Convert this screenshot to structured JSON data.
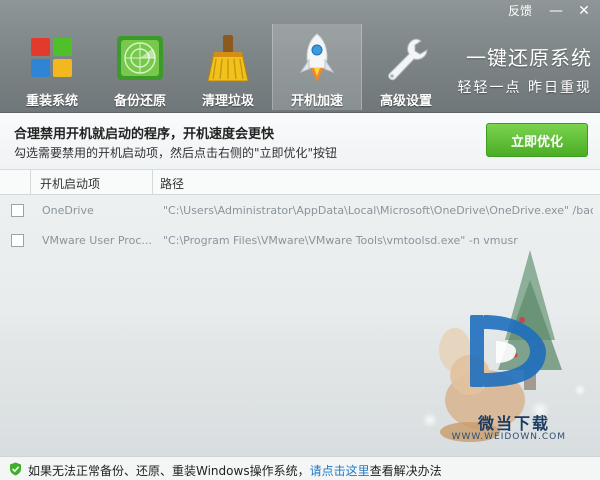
{
  "titlebar": {
    "feedback": "反馈",
    "minimize": "—",
    "close": "✕"
  },
  "nav": [
    {
      "label": "重装系统",
      "icon": "windows-logo-icon"
    },
    {
      "label": "备份还原",
      "icon": "radar-icon"
    },
    {
      "label": "清理垃圾",
      "icon": "broom-icon"
    },
    {
      "label": "开机加速",
      "icon": "rocket-icon",
      "active": true
    },
    {
      "label": "高级设置",
      "icon": "wrench-icon"
    }
  ],
  "slogan": {
    "line1": "一键还原系统",
    "line2": "轻轻一点 昨日重现"
  },
  "info": {
    "title": "合理禁用开机就启动的程序，开机速度会更快",
    "subtitle": "勾选需要禁用的开机启动项，然后点击右侧的\"立即优化\"按钮",
    "button": "立即优化"
  },
  "table": {
    "headers": [
      "开机启动项",
      "路径"
    ],
    "rows": [
      {
        "checked": false,
        "name": "OneDrive",
        "path": "\"C:\\Users\\Administrator\\AppData\\Local\\Microsoft\\OneDrive\\OneDrive.exe\" /background"
      },
      {
        "checked": false,
        "name": "VMware User Proc...",
        "path": "\"C:\\Program Files\\VMware\\VMware Tools\\vmtoolsd.exe\" -n vmusr"
      }
    ]
  },
  "footer": {
    "prefix": "如果无法正常备份、还原、重装Windows操作系统，",
    "link": "请点击这里",
    "suffix": "查看解决办法"
  },
  "watermark": {
    "brand": "微当下载",
    "url": "WWW.WEIDOWN.COM"
  },
  "colors": {
    "accent_green": "#4bad26",
    "link_blue": "#1e7ac8",
    "header_gray": "#7d8587"
  }
}
